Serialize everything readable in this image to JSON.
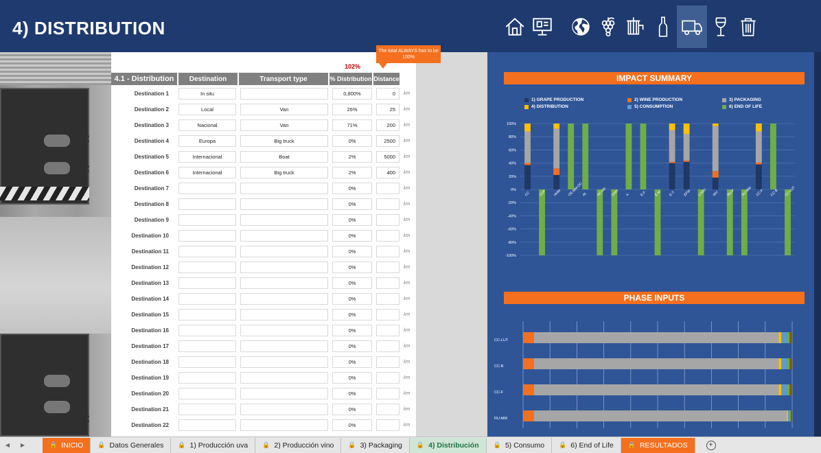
{
  "header": {
    "title": "4) DISTRIBUTION"
  },
  "nav": [
    {
      "name": "home-icon"
    },
    {
      "name": "presentation-icon"
    },
    {
      "name": "globe-icon"
    },
    {
      "name": "grape-icon"
    },
    {
      "name": "wine-press-icon"
    },
    {
      "name": "bottle-icon"
    },
    {
      "name": "truck-icon"
    },
    {
      "name": "wine-glass-icon"
    },
    {
      "name": "trash-icon"
    }
  ],
  "sheet": {
    "total_value": "102%",
    "callout": "The total ALWAYS has to be 100%",
    "headers": {
      "main": "4.1 - Distribution",
      "destination": "Destination",
      "transport": "Transport type",
      "pct": "% Distribution",
      "distance": "Distance"
    },
    "unit": "km",
    "rows": [
      {
        "label": "Destination 1",
        "destination": "In situ",
        "transport": "",
        "pct": "0,800%",
        "distance": "0"
      },
      {
        "label": "Destination 2",
        "destination": "Local",
        "transport": "Van",
        "pct": "26%",
        "distance": "25"
      },
      {
        "label": "Destination 3",
        "destination": "Nacional",
        "transport": "Van",
        "pct": "71%",
        "distance": "200"
      },
      {
        "label": "Destination 4",
        "destination": "Europa",
        "transport": "Big truck",
        "pct": "0%",
        "distance": "2500"
      },
      {
        "label": "Destination 5",
        "destination": "Internacional",
        "transport": "Boat",
        "pct": "2%",
        "distance": "5000"
      },
      {
        "label": "Destination 6",
        "destination": "Internacional",
        "transport": "Big truck",
        "pct": "2%",
        "distance": "400"
      },
      {
        "label": "Destination 7",
        "destination": "",
        "transport": "",
        "pct": "0%",
        "distance": ""
      },
      {
        "label": "Destination 8",
        "destination": "",
        "transport": "",
        "pct": "0%",
        "distance": ""
      },
      {
        "label": "Destination 9",
        "destination": "",
        "transport": "",
        "pct": "0%",
        "distance": ""
      },
      {
        "label": "Destination 10",
        "destination": "",
        "transport": "",
        "pct": "0%",
        "distance": ""
      },
      {
        "label": "Destination 11",
        "destination": "",
        "transport": "",
        "pct": "0%",
        "distance": ""
      },
      {
        "label": "Destination 12",
        "destination": "",
        "transport": "",
        "pct": "0%",
        "distance": ""
      },
      {
        "label": "Destination 13",
        "destination": "",
        "transport": "",
        "pct": "0%",
        "distance": ""
      },
      {
        "label": "Destination 14",
        "destination": "",
        "transport": "",
        "pct": "0%",
        "distance": ""
      },
      {
        "label": "Destination 15",
        "destination": "",
        "transport": "",
        "pct": "0%",
        "distance": ""
      },
      {
        "label": "Destination 16",
        "destination": "",
        "transport": "",
        "pct": "0%",
        "distance": ""
      },
      {
        "label": "Destination 17",
        "destination": "",
        "transport": "",
        "pct": "0%",
        "distance": ""
      },
      {
        "label": "Destination 18",
        "destination": "",
        "transport": "",
        "pct": "0%",
        "distance": ""
      },
      {
        "label": "Destination 19",
        "destination": "",
        "transport": "",
        "pct": "0%",
        "distance": ""
      },
      {
        "label": "Destination 20",
        "destination": "",
        "transport": "",
        "pct": "0%",
        "distance": ""
      },
      {
        "label": "Destination 21",
        "destination": "",
        "transport": "",
        "pct": "0%",
        "distance": ""
      },
      {
        "label": "Destination 22",
        "destination": "",
        "transport": "",
        "pct": "0%",
        "distance": ""
      }
    ]
  },
  "impact_summary": {
    "title": "IMPACT SUMMARY",
    "legend": [
      {
        "label": "1) GRAPE PRODUCTION",
        "color": "#1f3864"
      },
      {
        "label": "2) WINE PRODUCTION",
        "color": "#f4701e"
      },
      {
        "label": "3) PACKAGING",
        "color": "#a6a6a6"
      },
      {
        "label": "4) DISTRIBUTION",
        "color": "#ffc000"
      },
      {
        "label": "5) CONSUMPTION",
        "color": "#5b9bd5"
      },
      {
        "label": "6) END OF LIFE",
        "color": "#70ad47"
      }
    ],
    "yticks": [
      "100%",
      "80%",
      "60%",
      "40%",
      "20%",
      "0%",
      "-20%",
      "-40%",
      "-60%",
      "-80%",
      "-100%"
    ],
    "categories": [
      "CC",
      "CDP",
      "HHM",
      "OE-MM-OC",
      "RI",
      "HC-HE",
      "OHH",
      "A",
      "E-F",
      "E-M",
      "E-T",
      "EFW",
      "LHSU",
      "WU",
      "RU-F",
      "RU-MM",
      "CC-F",
      "CC-B",
      "CC-LUT"
    ]
  },
  "phase_inputs": {
    "title": "PHASE INPUTS",
    "categories": [
      "CC-LUT",
      "CC-B",
      "CC-F",
      "RU-MM"
    ]
  },
  "chart_data": [
    {
      "type": "bar",
      "title": "IMPACT SUMMARY",
      "categories": [
        "CC",
        "CDP",
        "HHM",
        "OE-MM-OC",
        "RI",
        "HC-HE",
        "OHH",
        "A",
        "E-F",
        "E-M",
        "E-T",
        "EFW",
        "LHSU",
        "WU",
        "RU-F",
        "RU-MM",
        "CC-F",
        "CC-B",
        "CC-LUT"
      ],
      "ylim": [
        -100,
        100
      ],
      "series": [
        {
          "name": "1) GRAPE PRODUCTION",
          "values": [
            37,
            0,
            22,
            0,
            0,
            0,
            0,
            0,
            0,
            0,
            40,
            42,
            0,
            18,
            0,
            0,
            38,
            0,
            0
          ]
        },
        {
          "name": "2) WINE PRODUCTION",
          "values": [
            3,
            0,
            10,
            0,
            0,
            0,
            0,
            0,
            0,
            0,
            2,
            2,
            0,
            10,
            0,
            0,
            3,
            0,
            0
          ]
        },
        {
          "name": "3) PACKAGING",
          "values": [
            48,
            0,
            60,
            0,
            0,
            0,
            0,
            0,
            0,
            0,
            48,
            40,
            0,
            68,
            0,
            0,
            47,
            0,
            0
          ]
        },
        {
          "name": "4) DISTRIBUTION",
          "values": [
            12,
            0,
            8,
            0,
            0,
            0,
            0,
            0,
            0,
            0,
            10,
            16,
            0,
            4,
            0,
            0,
            12,
            0,
            0
          ]
        },
        {
          "name": "5) CONSUMPTION",
          "values": [
            0,
            0,
            0,
            0,
            0,
            0,
            0,
            0,
            0,
            0,
            0,
            0,
            0,
            0,
            0,
            0,
            0,
            0,
            0
          ]
        },
        {
          "name": "6) END OF LIFE",
          "values": [
            0,
            -100,
            0,
            100,
            100,
            -100,
            -100,
            100,
            100,
            -100,
            0,
            0,
            -100,
            0,
            -100,
            -100,
            0,
            100,
            -100
          ]
        }
      ]
    },
    {
      "type": "bar",
      "title": "PHASE INPUTS",
      "orientation": "horizontal",
      "categories": [
        "CC-LUT",
        "CC-B",
        "CC-F",
        "RU-MM"
      ],
      "series": [
        {
          "name": "2) WINE PRODUCTION",
          "values": [
            4,
            4,
            4,
            4
          ]
        },
        {
          "name": "3) PACKAGING",
          "values": [
            91,
            91,
            91,
            94
          ]
        },
        {
          "name": "4) DISTRIBUTION",
          "values": [
            1,
            1,
            1,
            0.5
          ]
        },
        {
          "name": "5) CONSUMPTION",
          "values": [
            2,
            2,
            2,
            0.5
          ]
        },
        {
          "name": "6) END OF LIFE",
          "values": [
            1,
            1,
            1,
            0.5
          ]
        },
        {
          "name": "other",
          "values": [
            1,
            1,
            1,
            0.5
          ]
        }
      ]
    }
  ],
  "tabs": [
    {
      "label": "INICIO",
      "style": "orange"
    },
    {
      "label": "Datos Generales",
      "style": ""
    },
    {
      "label": "1) Producción uva",
      "style": ""
    },
    {
      "label": "2) Producción vino",
      "style": ""
    },
    {
      "label": "3) Packaging",
      "style": ""
    },
    {
      "label": "4) Distribución",
      "style": "sel"
    },
    {
      "label": "5) Consumo",
      "style": ""
    },
    {
      "label": "6) End of Life",
      "style": ""
    },
    {
      "label": "RESULTADOS",
      "style": "orange"
    }
  ]
}
